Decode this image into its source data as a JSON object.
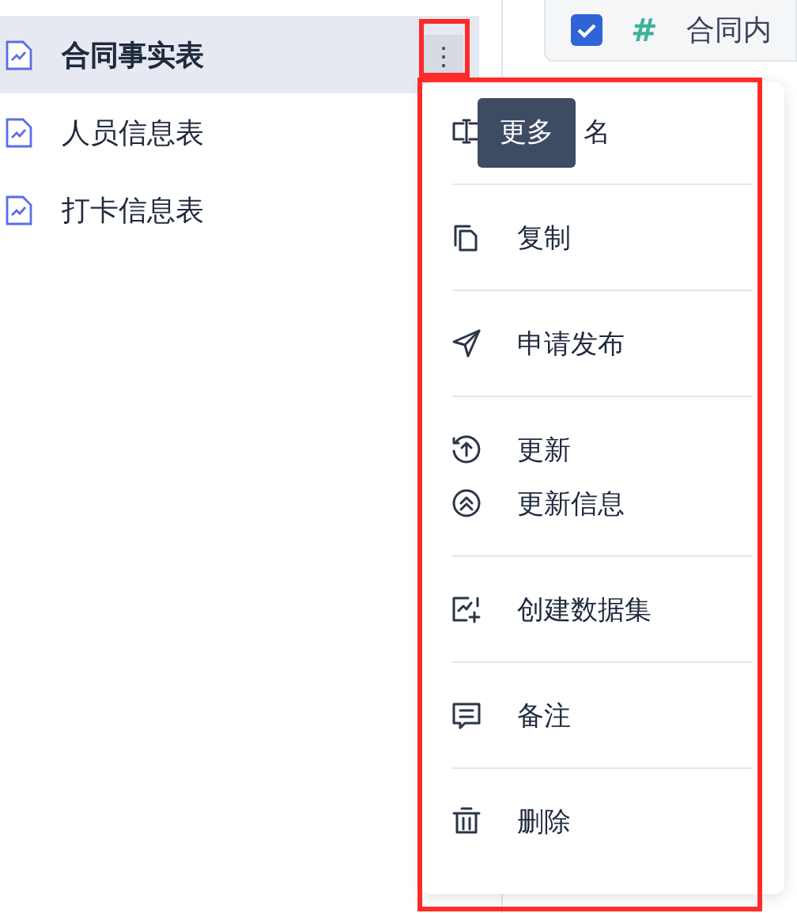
{
  "sidebar": {
    "items": [
      {
        "label": "合同事实表",
        "selected": true
      },
      {
        "label": "人员信息表",
        "selected": false
      },
      {
        "label": "打卡信息表",
        "selected": false
      }
    ]
  },
  "more_button": {
    "label": "⋮"
  },
  "tooltip": "更多",
  "menu": {
    "groups": [
      [
        {
          "kind": "rename",
          "label": "名"
        }
      ],
      [
        {
          "kind": "copy",
          "label": "复制"
        }
      ],
      [
        {
          "kind": "publish",
          "label": "申请发布"
        }
      ],
      [
        {
          "kind": "update",
          "label": "更新"
        },
        {
          "kind": "update_info",
          "label": "更新信息"
        }
      ],
      [
        {
          "kind": "dataset",
          "label": "创建数据集"
        }
      ],
      [
        {
          "kind": "note",
          "label": "备注"
        }
      ],
      [
        {
          "kind": "delete",
          "label": "删除"
        }
      ]
    ]
  },
  "field_header": {
    "checked": true,
    "type_symbol": "#",
    "label": "合同内"
  }
}
